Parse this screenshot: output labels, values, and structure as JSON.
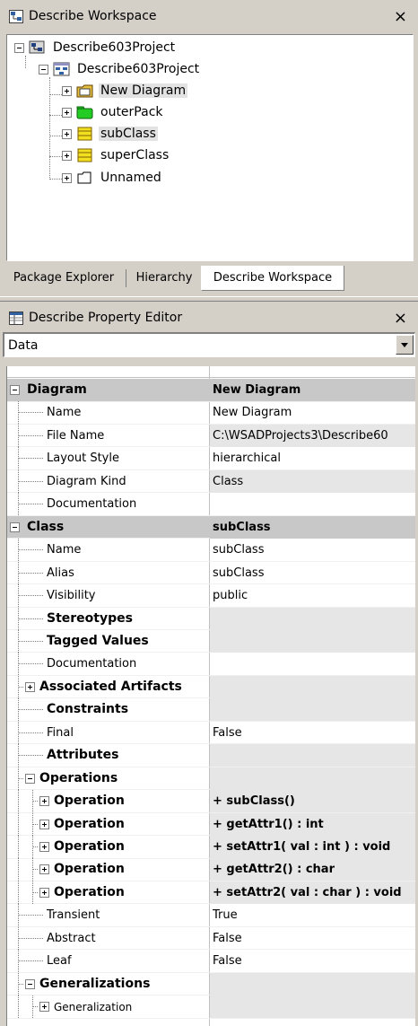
{
  "workspace": {
    "title": "Describe Workspace",
    "close": "×",
    "tree": [
      {
        "label": "Describe603Project",
        "icon": "project-icon",
        "expanded": true
      },
      {
        "label": "Describe603Project",
        "icon": "model-icon",
        "expanded": true
      },
      {
        "label": "New Diagram",
        "icon": "diagram-folder-icon",
        "selected": true
      },
      {
        "label": "outerPack",
        "icon": "package-icon"
      },
      {
        "label": "subClass",
        "icon": "class-icon",
        "selected": true
      },
      {
        "label": "superClass",
        "icon": "class-icon"
      },
      {
        "label": "Unnamed",
        "icon": "unnamed-icon"
      }
    ],
    "tabs": [
      "Package Explorer",
      "Hierarchy",
      "Describe Workspace"
    ],
    "active_tab": "Describe Workspace"
  },
  "property_editor": {
    "title": "Describe Property Editor",
    "close": "×",
    "view": "Data",
    "rows": [
      {
        "kind": "cat",
        "label": "Diagram",
        "value": "New Diagram"
      },
      {
        "label": "Name",
        "value": "New Diagram"
      },
      {
        "label": "File Name",
        "value": "C:\\WSADProjects3\\Describe60"
      },
      {
        "label": "Layout Style",
        "value": "hierarchical"
      },
      {
        "label": "Diagram Kind",
        "value": "Class"
      },
      {
        "label": "Documentation",
        "value": ""
      },
      {
        "kind": "cat",
        "label": "Class",
        "value": "subClass"
      },
      {
        "label": "Name",
        "value": "subClass"
      },
      {
        "label": "Alias",
        "value": "subClass"
      },
      {
        "label": "Visibility",
        "value": "public"
      },
      {
        "label": "Stereotypes",
        "value": "",
        "bold": true
      },
      {
        "label": "Tagged Values",
        "value": "",
        "bold": true
      },
      {
        "label": "Documentation",
        "value": ""
      },
      {
        "label": "Associated Artifacts",
        "value": "",
        "bold": true,
        "expander": "plus"
      },
      {
        "label": "Constraints",
        "value": "",
        "bold": true
      },
      {
        "label": "Final",
        "value": "False"
      },
      {
        "label": "Attributes",
        "value": "",
        "bold": true
      },
      {
        "label": "Operations",
        "value": "",
        "bold": true,
        "expander": "minus"
      },
      {
        "label": "Operation",
        "value": "+ subClass()",
        "bold": true,
        "expander": "plus",
        "indent": 2
      },
      {
        "label": "Operation",
        "value": "+ getAttr1() : int",
        "bold": true,
        "expander": "plus",
        "indent": 2
      },
      {
        "label": "Operation",
        "value": "+ setAttr1( val : int ) : void",
        "bold": true,
        "expander": "plus",
        "indent": 2
      },
      {
        "label": "Operation",
        "value": "+ getAttr2() : char",
        "bold": true,
        "expander": "plus",
        "indent": 2
      },
      {
        "label": "Operation",
        "value": "+ setAttr2( val : char ) : void",
        "bold": true,
        "expander": "plus",
        "indent": 2
      },
      {
        "label": "Transient",
        "value": "True"
      },
      {
        "label": "Abstract",
        "value": "False"
      },
      {
        "label": "Leaf",
        "value": "False"
      },
      {
        "label": "Generalizations",
        "value": "",
        "bold": true,
        "expander": "minus"
      },
      {
        "label": "Generalization",
        "value": "",
        "expander": "plus",
        "indent": 2
      }
    ]
  },
  "colors": {
    "chrome": "#d4d0c8",
    "category_row": "#c8c8c8",
    "readonly_cell": "#e6e6e6",
    "class_icon": "#f0e020",
    "package_icon": "#22cc22"
  }
}
